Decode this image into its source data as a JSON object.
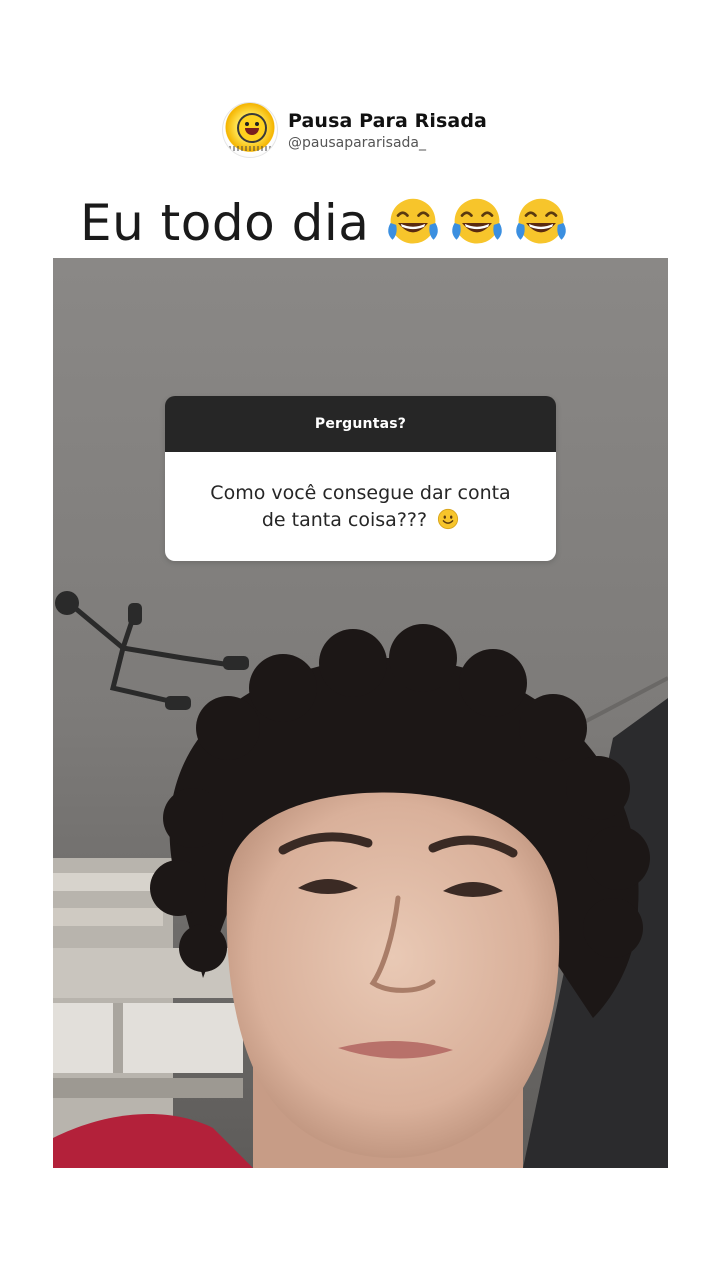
{
  "header": {
    "account_name": "Pausa Para Risada",
    "account_handle": "@pausapararisada_",
    "avatar_icon": "smiling-sun-logo"
  },
  "caption": {
    "text": "Eu todo dia",
    "emoji_icon": "face-with-tears-of-joy",
    "emoji_count": 3
  },
  "question_sticker": {
    "title": "Perguntas?",
    "question_line1": "Como você consegue dar conta",
    "question_line2": "de tanta coisa???",
    "emoji_icon": "smiling-face"
  },
  "colors": {
    "background": "#ffffff",
    "sticker_header": "#262626",
    "sticker_body": "#ffffff",
    "emoji_yellow": "#f7c52b",
    "emoji_tear_blue": "#3b8fe0"
  }
}
